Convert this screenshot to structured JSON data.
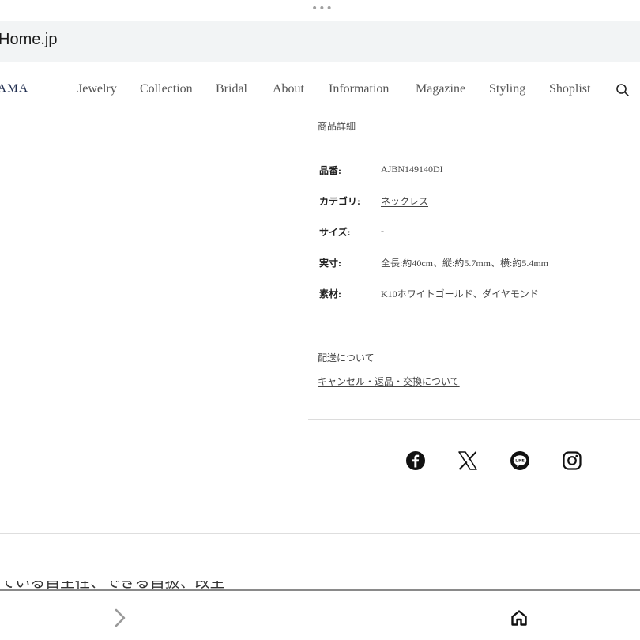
{
  "browser": {
    "dots": "•••",
    "url": "Home.jp"
  },
  "nav": {
    "logo": "AMA",
    "items": [
      "Jewelry",
      "Collection",
      "Bridal",
      "About",
      "Information",
      "Magazine",
      "Styling",
      "Shoplist"
    ],
    "search_icon": "search-icon"
  },
  "product": {
    "section_title": "商品詳細",
    "specs": [
      {
        "label": "品番:",
        "value": "AJBN149140DI"
      },
      {
        "label": "カテゴリ:",
        "value": "ネックレス"
      },
      {
        "label": "サイズ:",
        "value": "-"
      },
      {
        "label": "実寸:",
        "value": "全長:約40cm、縦:約5.7mm、横:約5.4mm"
      },
      {
        "label": "素材:",
        "value_prefix": "K10",
        "value_link1": "ホワイトゴールド",
        "value_sep": "、",
        "value_link2": "ダイヤモンド"
      }
    ],
    "links": [
      "配送について",
      "キャンセル・返品・交換について"
    ]
  },
  "social": {
    "icons": [
      "facebook-icon",
      "x-icon",
      "line-icon",
      "instagram-icon"
    ]
  },
  "bottom": {
    "partial_text": "ている自主性、できる自扱、改主",
    "forward_icon": "chevron-right-icon",
    "home_icon": "home-icon"
  }
}
